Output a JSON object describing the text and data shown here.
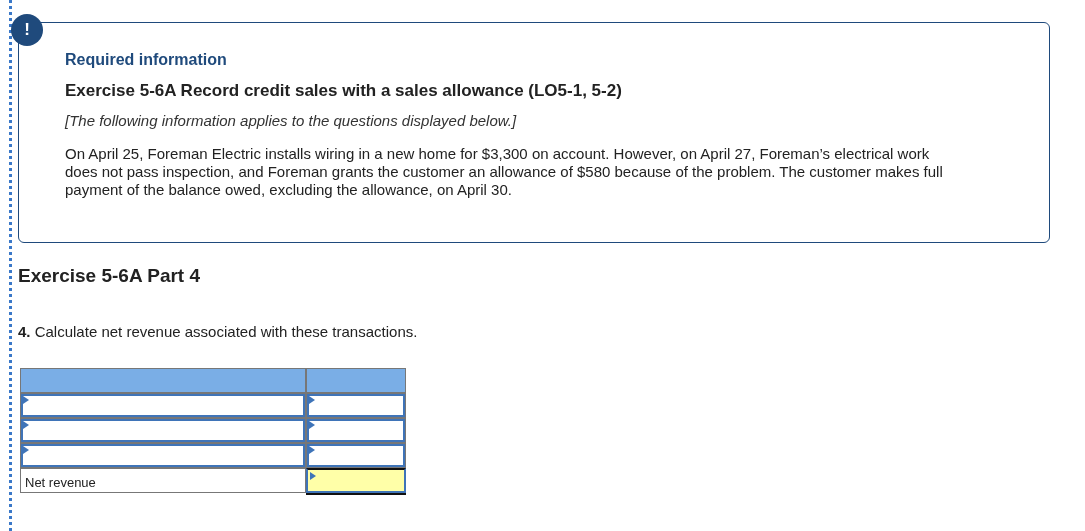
{
  "alert_icon": "!",
  "info_box": {
    "heading": "Required information",
    "title": "Exercise 5-6A Record credit sales with a sales allowance (LO5-1, 5-2)",
    "note": "[The following information applies to the questions displayed below.]",
    "body": "On April 25, Foreman Electric installs wiring in a new home for $3,300 on account. However, on April 27, Foreman’s electrical work does not pass inspection, and Foreman grants the customer an allowance of $580 because of the problem. The customer makes full payment of the balance owed, excluding the allowance, on April 30."
  },
  "part_title": "Exercise 5-6A Part 4",
  "question": "**4.** Calculate net revenue associated with these transactions.",
  "table": {
    "rows": [
      {
        "kind": "input"
      },
      {
        "kind": "input"
      },
      {
        "kind": "input"
      },
      {
        "kind": "total",
        "label": "Net revenue"
      }
    ]
  }
}
